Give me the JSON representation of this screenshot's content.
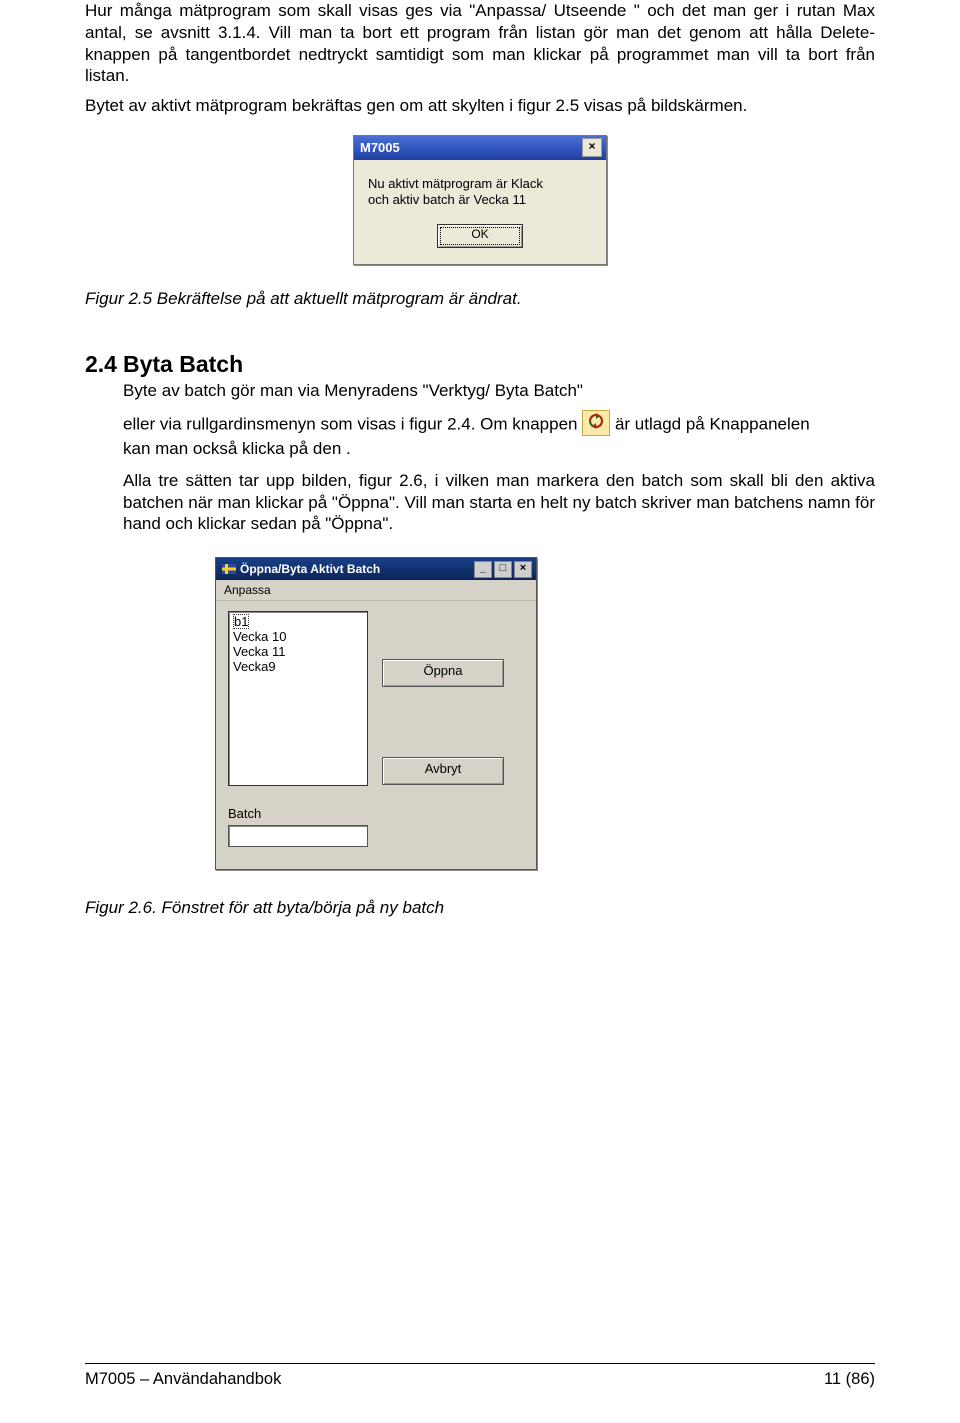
{
  "para1": "Hur många mätprogram som skall visas ges via \"Anpassa/ Utseende \" och det man ger i rutan Max antal, se avsnitt 3.1.4. Vill man ta bort ett program från listan gör man det genom att hålla Delete-knappen på tangentbordet nedtryckt samtidigt som man klickar på programmet man vill ta bort från listan.",
  "para2": "Bytet av aktivt mätprogram bekräftas gen om att skylten i figur 2.5 visas på bildskärmen.",
  "dialog1": {
    "title": "M7005",
    "close": "×",
    "line1": "Nu aktivt mätprogram är Klack",
    "line2": "och aktiv batch är Vecka 11",
    "ok": "OK"
  },
  "figcap1": "Figur 2.5 Bekräftelse på att aktuellt mätprogram är ändrat.",
  "section": {
    "num": "2.4",
    "title": "Byta Batch",
    "line1": "Byte av batch gör man via Menyradens \"Verktyg/ Byta Batch\"",
    "line2a": "eller via rullgardinsmenyn som visas i figur 2.4. Om knappen",
    "line2b": "är utlagd på Knappanelen",
    "line3": "kan man också klicka på den .",
    "para3": "Alla tre sätten tar upp bilden, figur 2.6, i vilken man markera den batch som skall bli den aktiva batchen när man klickar på \"Öppna\". Vill man starta en helt ny batch skriver man batchens namn för hand och klickar sedan på \"Öppna\"."
  },
  "dialog2": {
    "title": "Öppna/Byta Aktivt Batch",
    "menu": "Anpassa",
    "list": {
      "i0": "b1",
      "i1": "Vecka 10",
      "i2": "Vecka 11",
      "i3": "Vecka9"
    },
    "open": "Öppna",
    "cancel": "Avbryt",
    "label": "Batch",
    "min": "_",
    "max": "□",
    "close": "×"
  },
  "figcap2": "Figur 2.6. Fönstret för att byta/börja på ny batch",
  "footer": {
    "left": "M7005 – Användahandbok",
    "right": "11 (86)"
  }
}
